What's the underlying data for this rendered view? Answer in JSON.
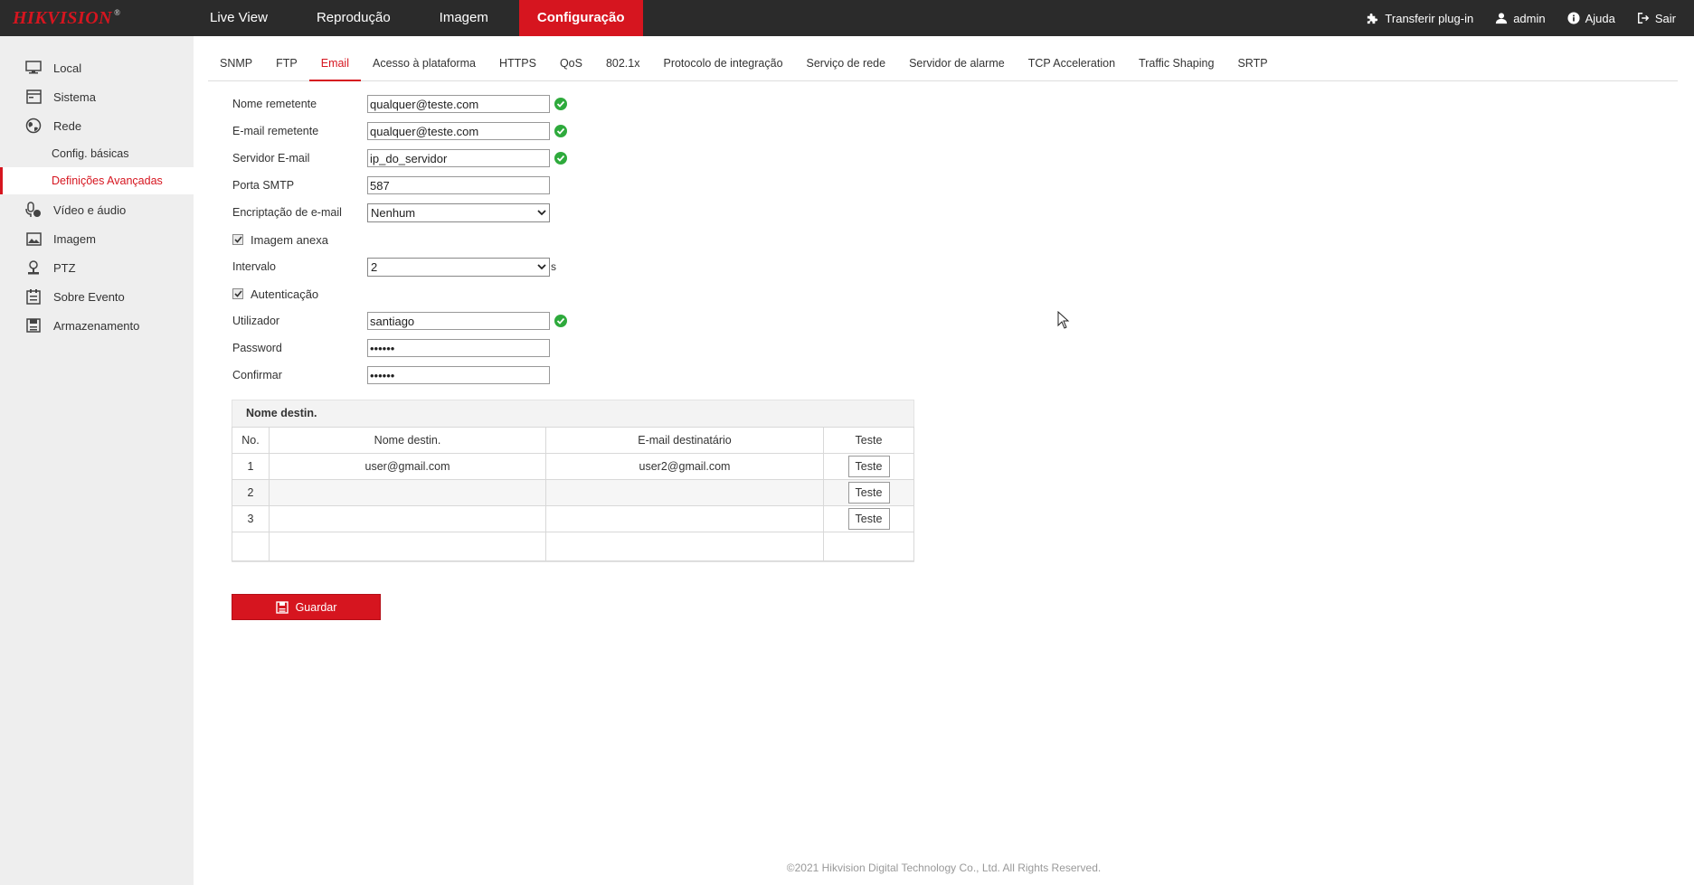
{
  "brand": {
    "logo": "HIKVISION",
    "reg": "®"
  },
  "nav": [
    {
      "label": "Live View"
    },
    {
      "label": "Reprodução"
    },
    {
      "label": "Imagem"
    },
    {
      "label": "Configuração",
      "active": true
    }
  ],
  "topright": {
    "plugin": "Transferir plug-in",
    "user": "admin",
    "help": "Ajuda",
    "logout": "Sair"
  },
  "sidebar": {
    "items": [
      {
        "label": "Local",
        "icon": "monitor-icon"
      },
      {
        "label": "Sistema",
        "icon": "system-icon"
      },
      {
        "label": "Rede",
        "icon": "globe-icon"
      },
      {
        "label": "Vídeo e áudio",
        "icon": "video-audio-icon"
      },
      {
        "label": "Imagem",
        "icon": "image-icon"
      },
      {
        "label": "PTZ",
        "icon": "ptz-icon"
      },
      {
        "label": "Sobre Evento",
        "icon": "calendar-icon"
      },
      {
        "label": "Armazenamento",
        "icon": "storage-icon"
      }
    ],
    "subitems": [
      {
        "label": "Config. básicas"
      },
      {
        "label": "Definições Avançadas",
        "active": true
      }
    ]
  },
  "tabs": [
    {
      "label": "SNMP"
    },
    {
      "label": "FTP"
    },
    {
      "label": "Email",
      "active": true
    },
    {
      "label": "Acesso à plataforma"
    },
    {
      "label": "HTTPS"
    },
    {
      "label": "QoS"
    },
    {
      "label": "802.1x"
    },
    {
      "label": "Protocolo de integração"
    },
    {
      "label": "Serviço de rede"
    },
    {
      "label": "Servidor de alarme"
    },
    {
      "label": "TCP Acceleration"
    },
    {
      "label": "Traffic Shaping"
    },
    {
      "label": "SRTP"
    }
  ],
  "form": {
    "sender_name": {
      "label": "Nome remetente",
      "value": "qualquer@teste.com"
    },
    "sender_email": {
      "label": "E-mail remetente",
      "value": "qualquer@teste.com"
    },
    "server": {
      "label": "Servidor E-mail",
      "value": "ip_do_servidor"
    },
    "port": {
      "label": "Porta SMTP",
      "value": "587"
    },
    "encryption": {
      "label": "Encriptação de e-mail",
      "value": "Nenhum"
    },
    "attach": {
      "label": "Imagem anexa",
      "checked": true
    },
    "interval": {
      "label": "Intervalo",
      "value": "2",
      "unit": "s"
    },
    "auth": {
      "label": "Autenticação",
      "checked": true
    },
    "user": {
      "label": "Utilizador",
      "value": "santiago"
    },
    "password": {
      "label": "Password",
      "value": "••••••"
    },
    "confirm": {
      "label": "Confirmar",
      "value": "••••••"
    }
  },
  "recipients": {
    "title": "Nome destin.",
    "headers": {
      "no": "No.",
      "name": "Nome destin.",
      "email": "E-mail destinatário",
      "test": "Teste"
    },
    "rows": [
      {
        "no": "1",
        "name": "user@gmail.com",
        "email": "user2@gmail.com",
        "test": "Teste"
      },
      {
        "no": "2",
        "name": "",
        "email": "",
        "test": "Teste"
      },
      {
        "no": "3",
        "name": "",
        "email": "",
        "test": "Teste"
      }
    ]
  },
  "save_label": "Guardar",
  "footer": "©2021 Hikvision Digital Technology Co., Ltd. All Rights Reserved.",
  "colors": {
    "accent": "#d6151f",
    "topbar": "#2b2b2b",
    "sidebar": "#eeeeee",
    "ok": "#2eaa3c"
  }
}
